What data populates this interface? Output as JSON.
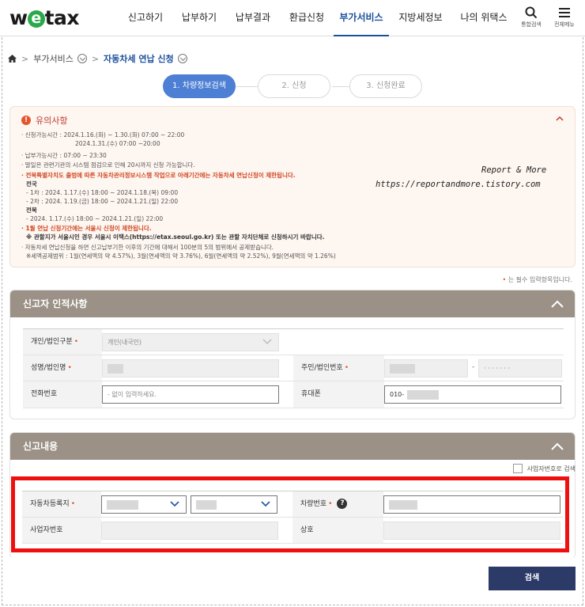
{
  "header": {
    "logo_pre": "w",
    "logo_e": "e",
    "logo_post": "tax",
    "nav": [
      "신고하기",
      "납부하기",
      "납부결과",
      "환급신청",
      "부가서비스",
      "지방세정보",
      "나의 위택스"
    ],
    "active_nav": "부가서비스",
    "search_label": "통합검색",
    "menu_label": "전체메뉴"
  },
  "breadcrumb": {
    "level1": "부가서비스",
    "current": "자동차세 연납 신청"
  },
  "steps": [
    "1. 차량정보검색",
    "2. 신청",
    "3. 신청완료"
  ],
  "notice": {
    "title": "유의사항",
    "lines": [
      "· 신청가능시간 : 2024.1.16.(화) ~ 1.30.(화) 07:00 ~ 22:00",
      "2024.1.31.(수) 07:00 ~20:00",
      "· 납부가능시간 : 07:00 ~ 23:30",
      "· 말일은 관련기관의 시스템 점검으로 인해 20시까지 신청 가능합니다.",
      "· 전북특별자치도 출범에 따른 자동차관리정보시스템 작업으로 아래기간에는 자동차세 연납신청이 제한됩니다.",
      "전국",
      "- 1차 : 2024. 1.17.(수) 18:00 ~ 2024.1.18.(목) 09:00",
      "- 2차 : 2024. 1.19.(금) 18:00 ~ 2024.1.21.(일) 22:00",
      "전북",
      "- 2024. 1.17.(수) 18:00 ~ 2024.1.21.(일) 22:00",
      "· 1월 연납 신청기간에는 서울시 신청이 제한됩니다.",
      "※ 관할지가 서울시인 경우 서울시 이택스(https://etax.seoul.go.kr) 또는 관할 자치단체로 신청하시기 바랍니다.",
      "· 자동차세 연납신청을 하면 신고납부기한 이후의 기간에 대해서 100분의 5의 범위에서 공제받습니다.",
      "※세액공제범위 : 1월(연세액의 약 4.57%), 3월(연세액의 약 3.76%), 6월(연세액의 약 2.52%), 9월(연세액의 약 1.26%)"
    ],
    "watermark_1": "Report & More",
    "watermark_2": "https://reportandmore.tistory.com"
  },
  "required_note": {
    "star": "•",
    "text": " 는 필수 입력항목입니다."
  },
  "reporter": {
    "title": "신고자 인적사항",
    "type_label": "개인/법인구분",
    "type_value": "개인(내국인)",
    "name_label": "성명/법인명",
    "id_label": "주민/법인번호",
    "id_mask": "· · · · · · ·",
    "phone_label": "전화번호",
    "phone_placeholder": "- 없이 입력하세요.",
    "mobile_label": "휴대폰",
    "mobile_prefix": "010-"
  },
  "report": {
    "title": "신고내용",
    "checkbox_label": "사업자번호로 검색",
    "region_label": "자동차등록지",
    "plate_label": "차량번호",
    "biz_label": "사업자번호",
    "company_label": "상호",
    "help_icon": "?"
  },
  "required_star": "•",
  "search_button": "검색",
  "colors": {
    "brand_blue": "#1a4f9c",
    "section_head": "#9b9186",
    "highlight_red": "#ee0f0f",
    "search_button": "#2b3a67"
  }
}
